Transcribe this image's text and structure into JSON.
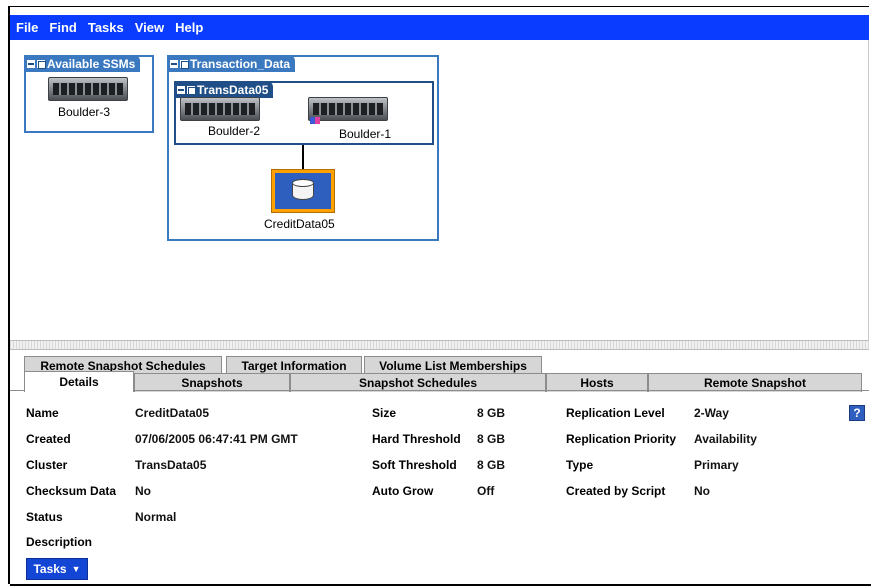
{
  "menu": [
    "File",
    "Find",
    "Tasks",
    "View",
    "Help"
  ],
  "groups": {
    "available": {
      "title": "Available SSMs",
      "nodes": [
        "Boulder-3"
      ]
    },
    "transaction": {
      "title": "Transaction_Data",
      "cluster": {
        "title": "TransData05",
        "nodes": [
          "Boulder-2",
          "Boulder-1"
        ]
      },
      "volume": "CreditData05"
    }
  },
  "tabs_row1": [
    "Remote Snapshot Schedules",
    "Target Information",
    "Volume List Memberships"
  ],
  "tabs_row2": [
    "Details",
    "Snapshots",
    "Snapshot Schedules",
    "Hosts",
    "Remote Snapshot"
  ],
  "details": {
    "col1": [
      {
        "label": "Name",
        "value": "CreditData05"
      },
      {
        "label": "Created",
        "value": "07/06/2005 06:47:41 PM GMT"
      },
      {
        "label": "Cluster",
        "value": "TransData05"
      },
      {
        "label": "Checksum Data",
        "value": "No"
      },
      {
        "label": "Status",
        "value": "Normal"
      },
      {
        "label": "Description",
        "value": ""
      }
    ],
    "col2": [
      {
        "label": "Size",
        "value": "8 GB"
      },
      {
        "label": "Hard Threshold",
        "value": "8 GB"
      },
      {
        "label": "Soft Threshold",
        "value": "8 GB"
      },
      {
        "label": "Auto Grow",
        "value": "Off"
      }
    ],
    "col3": [
      {
        "label": "Replication Level",
        "value": "2-Way"
      },
      {
        "label": "Replication Priority",
        "value": "Availability"
      },
      {
        "label": "Type",
        "value": "Primary"
      },
      {
        "label": "Created by Script",
        "value": "No"
      }
    ]
  },
  "help_label": "?",
  "tasks_button": "Tasks",
  "colors": {
    "menubar": "#0a3cff",
    "group_border": "#3a78c0",
    "volume_highlight": "#ffa200"
  }
}
